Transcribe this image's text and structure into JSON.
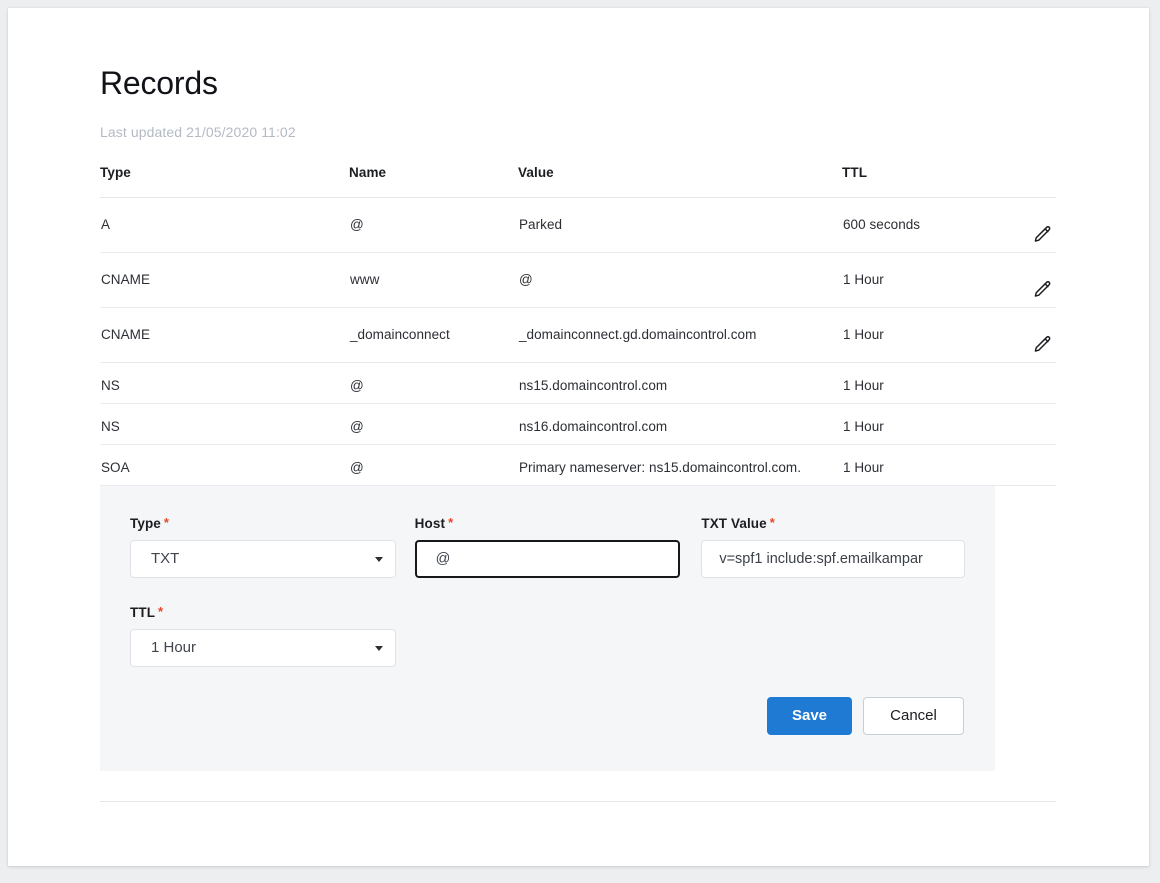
{
  "page": {
    "title": "Records",
    "last_updated": "Last updated 21/05/2020 11:02"
  },
  "table": {
    "columns": [
      "Type",
      "Name",
      "Value",
      "TTL"
    ],
    "rows": [
      {
        "type": "A",
        "name": "@",
        "value": "Parked",
        "ttl": "600 seconds",
        "editable": true
      },
      {
        "type": "CNAME",
        "name": "www",
        "value": "@",
        "ttl": "1 Hour",
        "editable": true
      },
      {
        "type": "CNAME",
        "name": "_domainconnect",
        "value": "_domainconnect.gd.domaincontrol.com",
        "ttl": "1 Hour",
        "editable": true
      },
      {
        "type": "NS",
        "name": "@",
        "value": "ns15.domaincontrol.com",
        "ttl": "1 Hour",
        "editable": false
      },
      {
        "type": "NS",
        "name": "@",
        "value": "ns16.domaincontrol.com",
        "ttl": "1 Hour",
        "editable": false
      },
      {
        "type": "SOA",
        "name": "@",
        "value": "Primary nameserver: ns15.domaincontrol.com.",
        "ttl": "1 Hour",
        "editable": false
      }
    ],
    "edit_icon": "pencil-icon"
  },
  "form": {
    "type": {
      "label": "Type",
      "required_marker": "*",
      "value": "TXT"
    },
    "host": {
      "label": "Host",
      "required_marker": "*",
      "value": "@"
    },
    "txt_value": {
      "label": "TXT Value",
      "required_marker": "*",
      "value": "v=spf1 include:spf.emailkampar"
    },
    "ttl": {
      "label": "TTL",
      "required_marker": "*",
      "value": "1 Hour"
    },
    "save_label": "Save",
    "cancel_label": "Cancel"
  },
  "colors": {
    "accent_blue": "#1f7ad4",
    "required_red": "#e8472a",
    "panel_background": "#f5f6f8",
    "muted_text": "#b3bac4"
  }
}
